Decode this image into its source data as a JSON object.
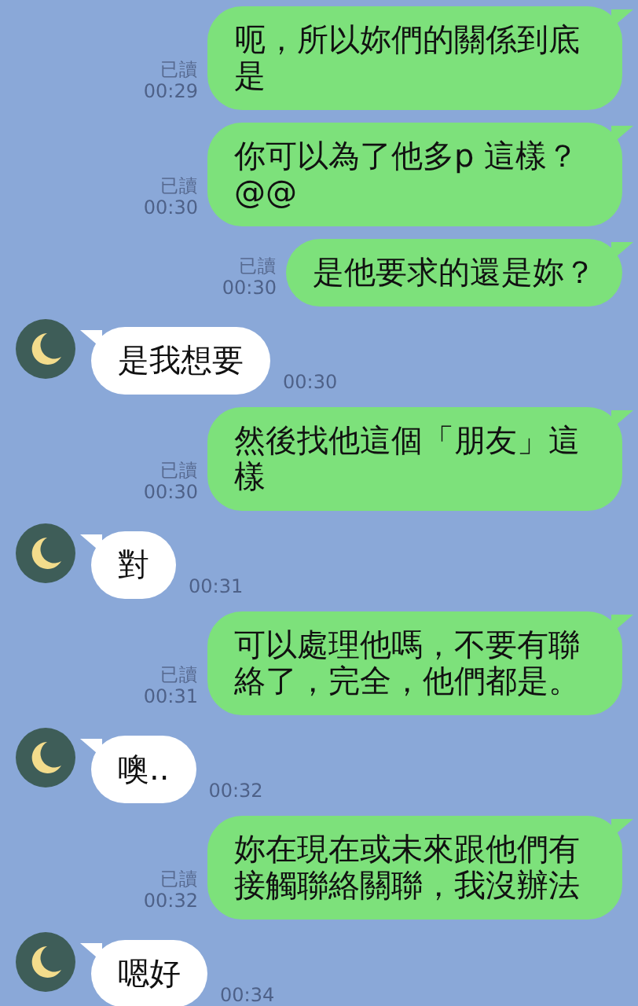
{
  "messages": [
    {
      "kind": "sent",
      "text": "呃，所以妳們的關係到底是",
      "read_label": "已讀",
      "time": "00:29"
    },
    {
      "kind": "sent",
      "text": "你可以為了他多p 這樣？@@",
      "read_label": "已讀",
      "time": "00:30"
    },
    {
      "kind": "sent",
      "text": "是他要求的還是妳？",
      "read_label": "已讀",
      "time": "00:30"
    },
    {
      "kind": "received",
      "text": "是我想要",
      "time": "00:30"
    },
    {
      "kind": "sent",
      "text": "然後找他這個「朋友」這樣",
      "read_label": "已讀",
      "time": "00:30"
    },
    {
      "kind": "received",
      "text": "對",
      "time": "00:31"
    },
    {
      "kind": "sent",
      "text": "可以處理他嗎，不要有聯絡了，完全，他們都是。",
      "read_label": "已讀",
      "time": "00:31"
    },
    {
      "kind": "received",
      "text": "噢..",
      "time": "00:32"
    },
    {
      "kind": "sent",
      "text": "妳在現在或未來跟他們有接觸聯絡關聯，我沒辦法",
      "read_label": "已讀",
      "time": "00:32"
    },
    {
      "kind": "received",
      "text": "嗯好",
      "time": "00:34"
    }
  ]
}
